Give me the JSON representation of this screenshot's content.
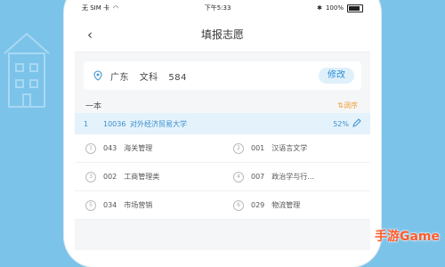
{
  "status_bar": {
    "carrier": "无 SIM 卡",
    "time": "下午5:33",
    "battery": "100%"
  },
  "nav": {
    "title": "填报志愿"
  },
  "profile": {
    "province": "广东",
    "track": "文科",
    "score": "584",
    "edit_label": "修改"
  },
  "section": {
    "label": "一本",
    "adjust_label": "调序"
  },
  "selected_school": {
    "index": "1",
    "code": "10036",
    "name": "对外经济贸易大学",
    "percent": "52%"
  },
  "majors": [
    {
      "num": "1",
      "code": "043",
      "name": "海关管理"
    },
    {
      "num": "2",
      "code": "001",
      "name": "汉语言文学"
    },
    {
      "num": "3",
      "code": "002",
      "name": "工商管理类"
    },
    {
      "num": "4",
      "code": "007",
      "name": "政治学与行..."
    },
    {
      "num": "5",
      "code": "034",
      "name": "市场营销"
    },
    {
      "num": "6",
      "code": "029",
      "name": "物流管理"
    }
  ],
  "watermark": "手游Game",
  "colors": {
    "accent": "#3a8fd0",
    "background": "#7cc3ea",
    "adjust": "#f0a23a",
    "watermark": "#ff5a2a"
  }
}
